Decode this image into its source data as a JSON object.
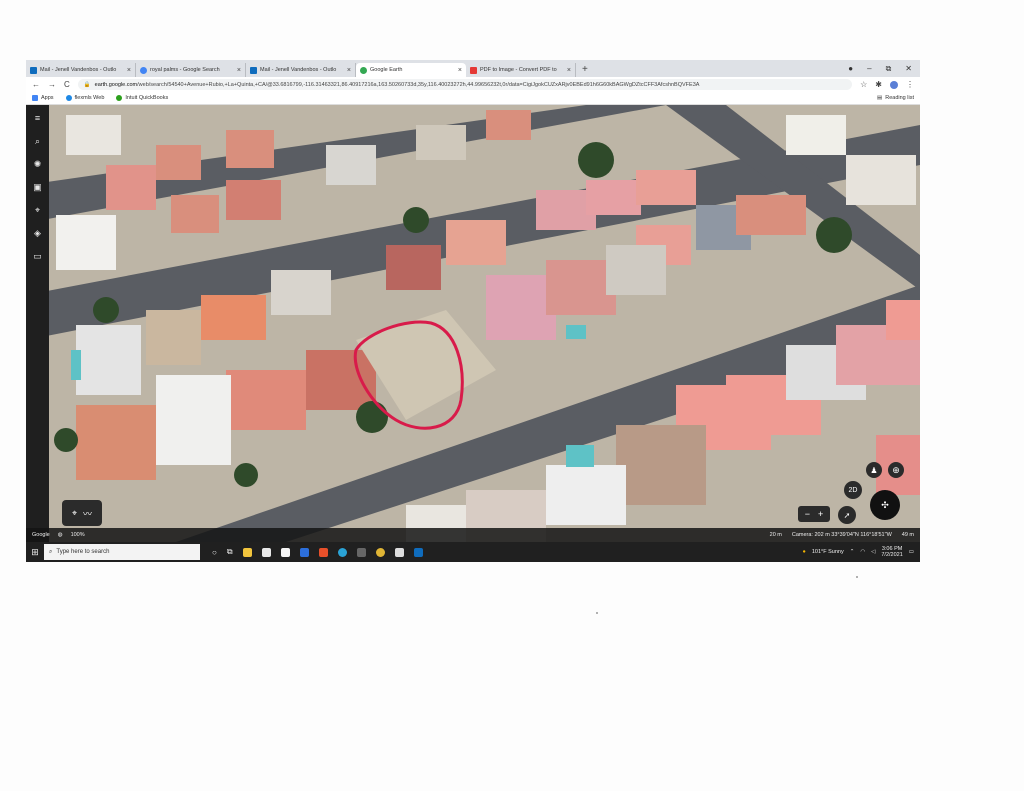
{
  "browser": {
    "tabs": [
      {
        "label": "Mail - Jenell Vandenbos - Outlo",
        "favicon_color": "#0f6cbd",
        "active": false
      },
      {
        "label": "royal palms - Google Search",
        "favicon_color": "#4285f4",
        "active": false
      },
      {
        "label": "Mail - Jenell Vandenbos - Outlo",
        "favicon_color": "#0f6cbd",
        "active": false
      },
      {
        "label": "Google Earth",
        "favicon_color": "#34a853",
        "active": true
      },
      {
        "label": "PDF to Image - Convert PDF to",
        "favicon_color": "#e53935",
        "active": false
      }
    ],
    "new_tab_glyph": "+",
    "window_controls": {
      "minimize": "–",
      "restore": "⧉",
      "close": "✕"
    },
    "nav": {
      "back": "←",
      "forward": "→",
      "reload": "C"
    },
    "address": {
      "host": "earth.google.com",
      "path": "/web/search/54540+Avenue+Rubio,+La+Quinta,+CA/@33.6816799,-116.31463321,86.40917216a,163.50260733d,35y,116.40023272h,44.99656232t,0r/data=CigiJgokCUZxARjv0EBEd91h6G60kBAGWgDZtcCFF3AfcshnBQVFE3A"
    },
    "bookmarks": [
      {
        "label": "Apps",
        "icon": "apps-grid-icon",
        "color": "#4285f4"
      },
      {
        "label": "flexmls Web",
        "icon": "flexmls-icon",
        "color": "#1e88e5"
      },
      {
        "label": "Intuit QuickBooks",
        "icon": "quickbooks-icon",
        "color": "#2ca01c"
      }
    ],
    "reading_list": "Reading list"
  },
  "earth": {
    "attribution": "Google",
    "zoom": "100%",
    "scale": "20 m",
    "camera": "Camera: 202 m   33°39'04\"N 116°18'51\"W",
    "elevation": "49 m",
    "view_mode": "2D",
    "zoom_out": "−",
    "zoom_in": "+",
    "highlight_color": "#d81b4a"
  },
  "taskbar": {
    "search_placeholder": "Type here to search",
    "weather": "101°F  Sunny",
    "time": "3:06 PM",
    "date": "7/2/2021"
  }
}
